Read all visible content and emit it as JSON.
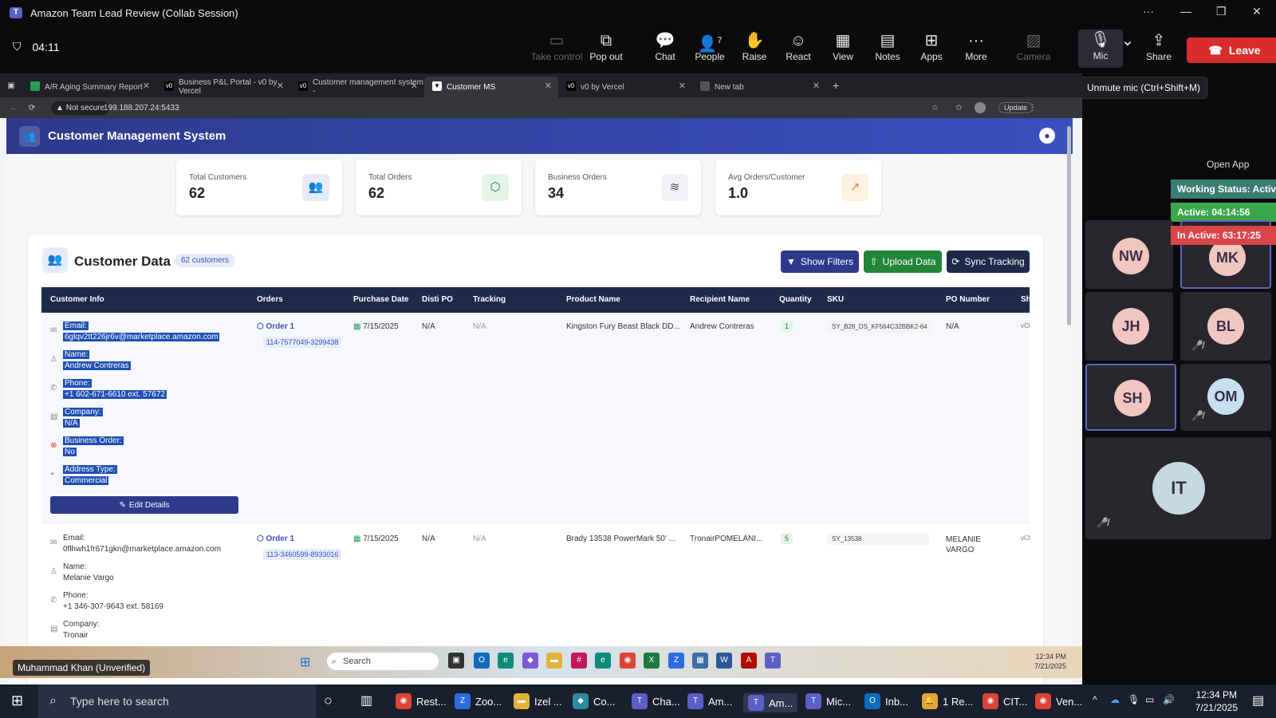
{
  "window": {
    "title": "Amazon Team Lead Review (Collab Session)"
  },
  "toolbar": {
    "timer": "04:11",
    "take_control": "Take control",
    "pop_out": "Pop out",
    "chat": "Chat",
    "people": "People",
    "people_count": "7",
    "raise": "Raise",
    "react": "React",
    "view": "View",
    "notes": "Notes",
    "apps": "Apps",
    "more": "More",
    "camera": "Camera",
    "mic": "Mic",
    "share": "Share",
    "leave": "Leave",
    "mic_tooltip": "Unmute mic (Ctrl+Shift+M)"
  },
  "browser": {
    "tabs": [
      {
        "label": "A/R Aging Summary Report"
      },
      {
        "label": "Business P&L Portal - v0 by Vercel"
      },
      {
        "label": "Customer management system -"
      },
      {
        "label": "Customer MS"
      },
      {
        "label": "v0 by Vercel"
      },
      {
        "label": "New tab"
      }
    ],
    "not_secure": "Not secure",
    "url": "199.188.207.24:5433",
    "update": "Update"
  },
  "app": {
    "title": "Customer Management System",
    "stats": [
      {
        "label": "Total Customers",
        "value": "62"
      },
      {
        "label": "Total Orders",
        "value": "62"
      },
      {
        "label": "Business Orders",
        "value": "34"
      },
      {
        "label": "Avg Orders/Customer",
        "value": "1.0"
      }
    ],
    "panel_title": "Customer Data",
    "panel_badge": "62 customers",
    "show_filters": "Show Filters",
    "upload_data": "Upload Data",
    "sync_tracking": "Sync Tracking",
    "columns": [
      "Customer Info",
      "Orders",
      "Purchase Date",
      "Disti PO",
      "Tracking",
      "Product Name",
      "Recipient Name",
      "Quantity",
      "SKU",
      "PO Number",
      "Sh"
    ],
    "rows": [
      {
        "email_label": "Email:",
        "email": "6glqv2tt226jr6v@marketplace.amazon.com",
        "name_label": "Name:",
        "name": "Andrew Contreras",
        "phone_label": "Phone:",
        "phone": "+1 602-671-6610 ext. 57672",
        "company_label": "Company:",
        "company": "N/A",
        "business_label": "Business Order:",
        "business": "No",
        "address_label": "Address Type:",
        "address": "Commercial",
        "edit": "Edit Details",
        "order": "Order 1",
        "order_no": "114-7577049-3299438",
        "date": "7/15/2025",
        "disti": "N/A",
        "tracking": "N/A",
        "product": "Kingston Fury Beast Black DD...",
        "recipient": "Andrew Contreras",
        "qty": "1",
        "sku": "SY_B28_DS_KF564C32BBK2-64",
        "po": "N/A",
        "sh": "vCl"
      },
      {
        "email_label": "Email:",
        "email": "0flhwh1fr671gkn@marketplace.amazon.com",
        "name_label": "Name:",
        "name": "Melanie Vargo",
        "phone_label": "Phone:",
        "phone": "+1 346-307-9643 ext. 58169",
        "company_label": "Company:",
        "company": "Tronair",
        "order": "Order 1",
        "order_no": "113-3460599-8933016",
        "date": "7/15/2025",
        "disti": "N/A",
        "tracking": "N/A",
        "product": "Brady 13538 PowerMark 50' ...",
        "recipient": "TronairPOMELANI...",
        "qty": "5",
        "sku": "SY_13538",
        "po": "MELANIE VARGO",
        "sh": "vCl"
      }
    ]
  },
  "presenter_taskbar": {
    "search": "Search",
    "time": "12:34 PM",
    "date": "7/21/2025"
  },
  "presenter_name": "Muhammad Khan (Unverified)",
  "participants": {
    "open_app": "Open App",
    "working_status": "Working Status: Active",
    "active": "Active: 04:14:56",
    "inactive": "In Active: 63:17:25",
    "tiles": [
      {
        "initials": "NW",
        "color": "#f2c6c0"
      },
      {
        "initials": "MK",
        "color": "#f2c6c0"
      },
      {
        "initials": "JH",
        "color": "#f2c6c0"
      },
      {
        "initials": "BL",
        "color": "#f2c6c0"
      },
      {
        "initials": "SH",
        "color": "#f2c6c0"
      },
      {
        "initials": "OM",
        "color": "#c7dff0"
      },
      {
        "initials": "IT",
        "color": "#c5d9e0"
      }
    ]
  },
  "windows_taskbar": {
    "search_placeholder": "Type here to search",
    "apps": [
      "Rest...",
      "Zoo...",
      "Izel ...",
      "Co...",
      "Cha...",
      "Am...",
      "Am...",
      "Mic...",
      "Inb...",
      "1 Re...",
      "CIT...",
      "Ven..."
    ],
    "time": "12:34 PM",
    "date": "7/21/2025"
  }
}
